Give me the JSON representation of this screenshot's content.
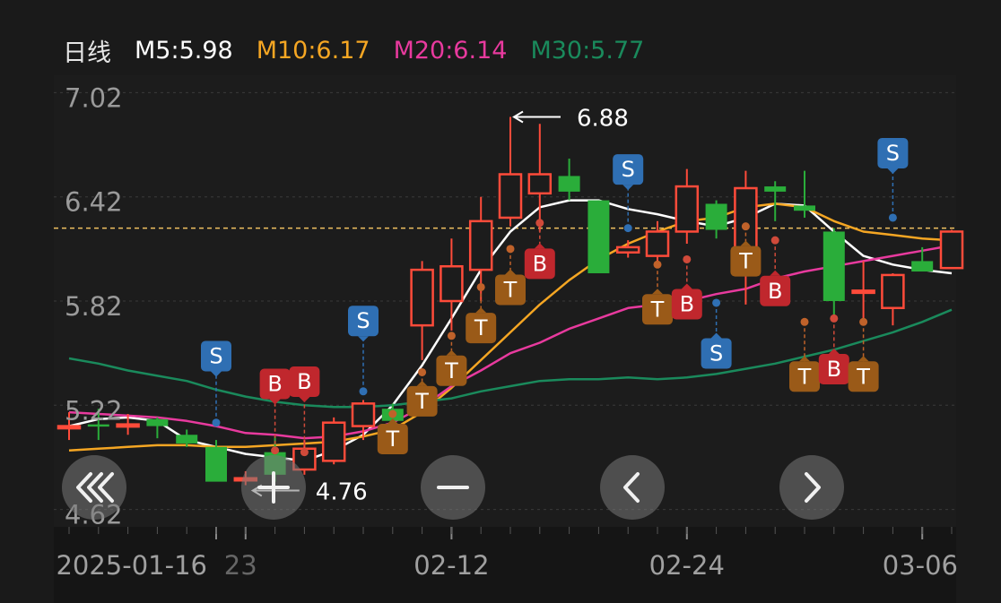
{
  "legend": {
    "period_label": "日线",
    "ma5": "M5:5.98",
    "ma10": "M10:6.17",
    "ma20": "M20:6.14",
    "ma30": "M30:5.77"
  },
  "colors": {
    "background": "#1a1a1a",
    "up": "#ff4b3a",
    "down": "#2aad3a",
    "ma5": "#ffffff",
    "ma10": "#f5a623",
    "ma20": "#e83a9e",
    "ma30": "#1a8a5c",
    "buy_marker": "#c0272d",
    "sell_marker": "#2f6fb3",
    "t_marker": "#9a5a18",
    "last_price_line": "#f0c060"
  },
  "chart_data": {
    "type": "candlestick",
    "ylim": [
      4.52,
      7.12
    ],
    "y_ticks": [
      "7.02",
      "6.42",
      "5.82",
      "5.22",
      "4.62"
    ],
    "y_tick_values": [
      7.02,
      6.42,
      5.82,
      5.22,
      4.62
    ],
    "x_tick_labels": [
      "2025-01-16",
      "23",
      "02-12",
      "02-24",
      "03-06"
    ],
    "x_tick_index": [
      5,
      6,
      13,
      21,
      29
    ],
    "high_annotation": {
      "label": "6.88",
      "value": 6.88
    },
    "low_annotation": {
      "label": "4.76",
      "value": 4.76
    },
    "last_price_line": 6.24,
    "candles": [
      {
        "o": 5.1,
        "h": 5.18,
        "l": 5.02,
        "c": 5.1
      },
      {
        "o": 5.11,
        "h": 5.2,
        "l": 5.02,
        "c": 5.1
      },
      {
        "o": 5.11,
        "h": 5.17,
        "l": 5.05,
        "c": 5.11
      },
      {
        "o": 5.14,
        "h": 5.15,
        "l": 5.03,
        "c": 5.1
      },
      {
        "o": 5.05,
        "h": 5.08,
        "l": 4.98,
        "c": 5.0
      },
      {
        "o": 4.98,
        "h": 5.02,
        "l": 4.98,
        "c": 4.78
      },
      {
        "o": 4.8,
        "h": 4.84,
        "l": 4.76,
        "c": 4.8
      },
      {
        "o": 4.95,
        "h": 5.04,
        "l": 4.78,
        "c": 4.82
      },
      {
        "o": 4.85,
        "h": 5.02,
        "l": 4.82,
        "c": 4.97
      },
      {
        "o": 4.9,
        "h": 5.15,
        "l": 4.88,
        "c": 5.12
      },
      {
        "o": 5.1,
        "h": 5.25,
        "l": 5.02,
        "c": 5.23
      },
      {
        "o": 5.2,
        "h": 5.23,
        "l": 5.08,
        "c": 5.13
      },
      {
        "o": 5.68,
        "h": 6.05,
        "l": 5.48,
        "c": 6.0
      },
      {
        "o": 5.82,
        "h": 6.18,
        "l": 5.65,
        "c": 6.02
      },
      {
        "o": 6.0,
        "h": 6.42,
        "l": 5.82,
        "c": 6.28
      },
      {
        "o": 6.3,
        "h": 6.88,
        "l": 6.25,
        "c": 6.55
      },
      {
        "o": 6.44,
        "h": 6.84,
        "l": 6.22,
        "c": 6.55
      },
      {
        "o": 6.54,
        "h": 6.64,
        "l": 6.4,
        "c": 6.45
      },
      {
        "o": 6.4,
        "h": 6.4,
        "l": 5.98,
        "c": 5.98
      },
      {
        "o": 6.1,
        "h": 6.17,
        "l": 6.07,
        "c": 6.13
      },
      {
        "o": 6.08,
        "h": 6.28,
        "l": 6.02,
        "c": 6.22
      },
      {
        "o": 6.22,
        "h": 6.58,
        "l": 6.15,
        "c": 6.48
      },
      {
        "o": 6.38,
        "h": 6.4,
        "l": 6.18,
        "c": 6.23
      },
      {
        "o": 6.02,
        "h": 6.57,
        "l": 5.8,
        "c": 6.47
      },
      {
        "o": 6.48,
        "h": 6.51,
        "l": 6.28,
        "c": 6.45
      },
      {
        "o": 6.37,
        "h": 6.57,
        "l": 6.3,
        "c": 6.34
      },
      {
        "o": 6.22,
        "h": 6.24,
        "l": 5.7,
        "c": 5.82
      },
      {
        "o": 5.88,
        "h": 6.05,
        "l": 5.7,
        "c": 5.88
      },
      {
        "o": 5.78,
        "h": 5.98,
        "l": 5.68,
        "c": 5.97
      },
      {
        "o": 6.05,
        "h": 6.13,
        "l": 6.02,
        "c": 5.99
      },
      {
        "o": 6.01,
        "h": 6.23,
        "l": 6.01,
        "c": 6.22
      }
    ],
    "series": [
      {
        "name": "M5",
        "values": [
          5.1,
          5.14,
          5.15,
          5.13,
          5.02,
          4.98,
          4.94,
          4.92,
          4.9,
          4.96,
          5.05,
          5.22,
          5.45,
          5.72,
          6.0,
          6.22,
          6.36,
          6.4,
          6.4,
          6.35,
          6.32,
          6.28,
          6.25,
          6.3,
          6.38,
          6.37,
          6.22,
          6.08,
          6.03,
          6.0,
          5.98
        ]
      },
      {
        "name": "M10",
        "values": [
          4.96,
          4.97,
          4.98,
          4.99,
          4.99,
          4.98,
          4.98,
          4.99,
          5.0,
          5.01,
          5.04,
          5.08,
          5.18,
          5.32,
          5.48,
          5.64,
          5.8,
          5.94,
          6.06,
          6.15,
          6.22,
          6.28,
          6.3,
          6.36,
          6.38,
          6.36,
          6.28,
          6.22,
          6.2,
          6.18,
          6.17
        ]
      },
      {
        "name": "M20",
        "values": [
          5.18,
          5.17,
          5.16,
          5.15,
          5.13,
          5.1,
          5.06,
          5.05,
          5.03,
          5.04,
          5.07,
          5.12,
          5.21,
          5.33,
          5.42,
          5.52,
          5.58,
          5.66,
          5.72,
          5.78,
          5.8,
          5.82,
          5.86,
          5.89,
          5.95,
          5.99,
          6.02,
          6.05,
          6.08,
          6.11,
          6.14
        ]
      },
      {
        "name": "M30",
        "values": [
          5.49,
          5.46,
          5.42,
          5.39,
          5.36,
          5.31,
          5.27,
          5.24,
          5.22,
          5.21,
          5.21,
          5.22,
          5.24,
          5.26,
          5.3,
          5.33,
          5.36,
          5.37,
          5.37,
          5.38,
          5.37,
          5.38,
          5.4,
          5.43,
          5.46,
          5.5,
          5.54,
          5.59,
          5.64,
          5.7,
          5.77
        ]
      }
    ],
    "markers": [
      {
        "index": 5,
        "type": "S",
        "value": 5.12,
        "side": "above",
        "offset": 2.6
      },
      {
        "index": 7,
        "type": "B",
        "value": 4.96,
        "side": "above",
        "offset": 2.6
      },
      {
        "index": 8,
        "type": "B",
        "value": 4.95,
        "side": "above",
        "offset": 2.8
      },
      {
        "index": 10,
        "type": "S",
        "value": 5.3,
        "side": "above",
        "offset": 2.8
      },
      {
        "index": 11,
        "type": "T",
        "value": 5.17,
        "side": "below",
        "offset": 0.5
      },
      {
        "index": 12,
        "type": "T",
        "value": 5.41,
        "side": "below",
        "offset": 0.7
      },
      {
        "index": 13,
        "type": "T",
        "value": 5.62,
        "side": "below",
        "offset": 1.0
      },
      {
        "index": 14,
        "type": "T",
        "value": 5.9,
        "side": "below",
        "offset": 1.3
      },
      {
        "index": 15,
        "type": "T",
        "value": 6.12,
        "side": "below",
        "offset": 1.3
      },
      {
        "index": 16,
        "type": "B",
        "value": 6.27,
        "side": "below",
        "offset": 1.3
      },
      {
        "index": 19,
        "type": "S",
        "value": 6.24,
        "side": "above",
        "offset": 2.2
      },
      {
        "index": 20,
        "type": "T",
        "value": 6.03,
        "side": "below",
        "offset": 1.5
      },
      {
        "index": 21,
        "type": "B",
        "value": 6.06,
        "side": "below",
        "offset": 1.5
      },
      {
        "index": 22,
        "type": "S",
        "value": 5.81,
        "side": "below",
        "offset": 1.8
      },
      {
        "index": 23,
        "type": "T",
        "value": 6.25,
        "side": "below",
        "offset": 1.0
      },
      {
        "index": 24,
        "type": "B",
        "value": 6.17,
        "side": "below",
        "offset": 1.8
      },
      {
        "index": 25,
        "type": "T",
        "value": 5.7,
        "side": "below",
        "offset": 2.0
      },
      {
        "index": 26,
        "type": "B",
        "value": 5.72,
        "side": "below",
        "offset": 1.8
      },
      {
        "index": 27,
        "type": "T",
        "value": 5.7,
        "side": "below",
        "offset": 2.0
      },
      {
        "index": 28,
        "type": "S",
        "value": 6.3,
        "side": "above",
        "offset": 2.5
      }
    ]
  },
  "controls": [
    {
      "name": "rewind-button",
      "icon": "double-chevron-left-icon"
    },
    {
      "name": "zoom-in-button",
      "icon": "plus-icon"
    },
    {
      "name": "zoom-out-button",
      "icon": "minus-icon"
    },
    {
      "name": "scroll-left-button",
      "icon": "chevron-left-icon"
    },
    {
      "name": "scroll-right-button",
      "icon": "chevron-right-icon"
    }
  ]
}
